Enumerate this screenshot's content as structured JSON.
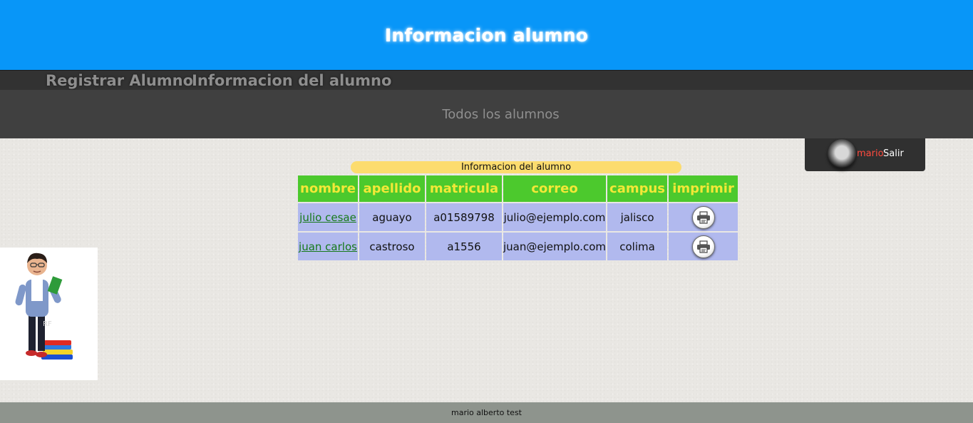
{
  "header": {
    "title": "Informacion alumno"
  },
  "nav": {
    "items": [
      {
        "label": "Registrar Alumno"
      },
      {
        "label": "Informacion del alumno"
      }
    ]
  },
  "subnav": {
    "label": "Todos los alumnos"
  },
  "user": {
    "name": "mario",
    "logout_label": "Salir"
  },
  "table": {
    "caption": "Informacion del alumno",
    "headers": [
      "nombre",
      "apellido",
      "matricula",
      "correo",
      "campus",
      "imprimir"
    ],
    "rows": [
      {
        "nombre": "julio cesae",
        "apellido": "aguayo",
        "matricula": "a01589798",
        "correo": "julio@ejemplo.com",
        "campus": "jalisco",
        "imprimir_icon": "printer-icon"
      },
      {
        "nombre": "juan carlos",
        "apellido": "castroso",
        "matricula": "a1556",
        "correo": "juan@ejemplo.com",
        "campus": "colima",
        "imprimir_icon": "printer-icon"
      }
    ]
  },
  "footer": {
    "text": "mario alberto test"
  },
  "colors": {
    "header_bg": "#0896f8",
    "nav_bg": "#323232",
    "subnav_bg": "#404040",
    "table_header_bg": "#4cc92d",
    "table_header_text": "#f2e837",
    "table_cell_bg": "#b1b9ee",
    "caption_bg": "#fcdc6e",
    "link_color": "#16791a",
    "username_color": "#ff4b3e",
    "footer_bg": "#8e948d"
  }
}
